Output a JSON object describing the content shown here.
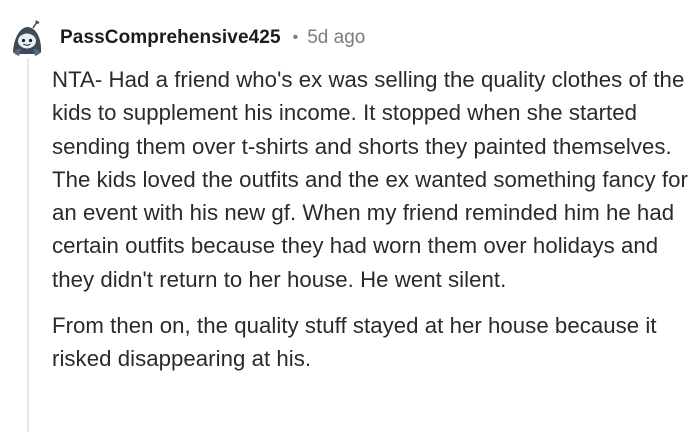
{
  "comment": {
    "username": "PassComprehensive425",
    "separator": "•",
    "timestamp": "5d ago",
    "avatar_icon": "snoo-avatar-icon",
    "paragraphs": [
      "NTA- Had a friend who's ex was selling the quality clothes of the kids to supplement his income. It stopped when she started sending them over t-shirts and shorts they painted themselves. The kids loved the outfits and the ex wanted something fancy for an event with his new gf. When my friend reminded him he had certain outfits because they had worn them over holidays and they didn't return to her house. He went silent.",
      "From then on, the quality stuff stayed at her house because it risked disappearing at his."
    ]
  },
  "colors": {
    "text": "#2a2a2a",
    "meta": "#7c7c7c",
    "thread_line": "#e7e7e7",
    "avatar_bg": "#3d4a57"
  }
}
